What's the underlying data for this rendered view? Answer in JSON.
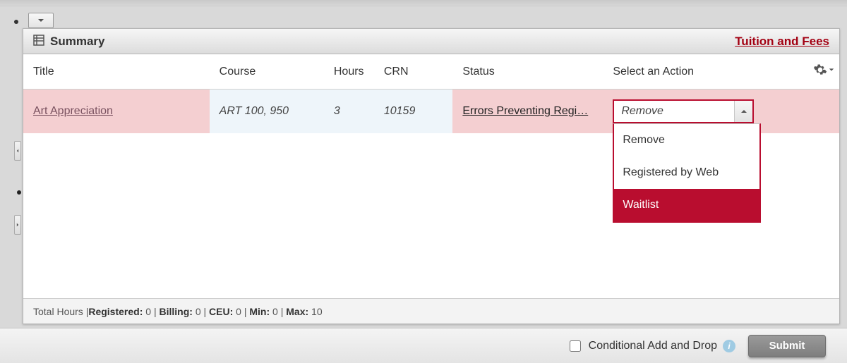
{
  "header": {
    "title": "Summary",
    "tuition_link": "Tuition and Fees"
  },
  "columns": {
    "title": "Title",
    "course": "Course",
    "hours": "Hours",
    "crn": "CRN",
    "status": "Status",
    "action": "Select an Action"
  },
  "rows": [
    {
      "title": "Art Appreciation",
      "course": "ART 100, 950",
      "hours": "3",
      "crn": "10159",
      "status": "Errors Preventing Regi…",
      "selected_action": "Remove"
    }
  ],
  "action_options": [
    {
      "label": "Remove",
      "selected": false
    },
    {
      "label": "Registered by Web",
      "selected": false
    },
    {
      "label": "Waitlist",
      "selected": true
    }
  ],
  "totals": {
    "prefix": "Total Hours | ",
    "registered_label": "Registered:",
    "registered": "0",
    "billing_label": "Billing:",
    "billing": "0",
    "ceu_label": "CEU:",
    "ceu": "0",
    "min_label": "Min:",
    "min": "0",
    "max_label": "Max:",
    "max": "10"
  },
  "bottom": {
    "conditional_label": "Conditional Add and Drop",
    "submit": "Submit"
  },
  "colors": {
    "brand_red": "#b90d2f",
    "error_row": "#f4cfd1"
  }
}
